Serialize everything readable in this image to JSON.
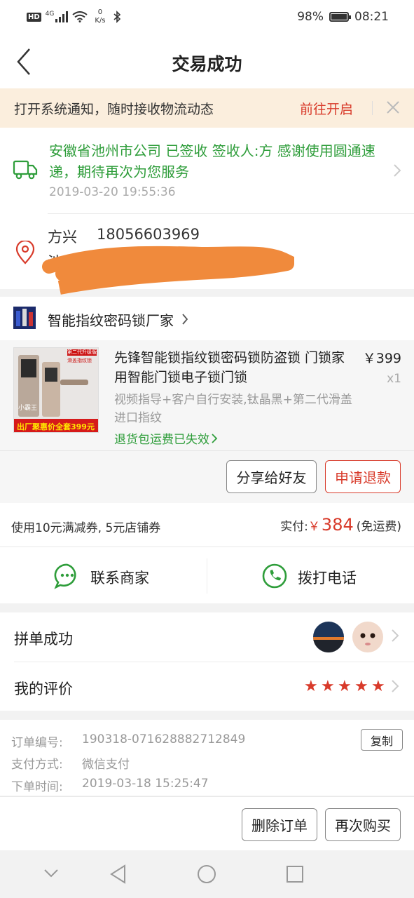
{
  "status_bar": {
    "hd": "HD",
    "network": "4G",
    "speed_value": "0",
    "speed_unit": "K/s",
    "battery": "98%",
    "battery_level": 0.98,
    "time": "08:21"
  },
  "header": {
    "title": "交易成功"
  },
  "notice": {
    "text": "打开系统通知，随时接收物流动态",
    "action": "前往开启"
  },
  "logistics": {
    "status": "安徽省池州市公司 已签收 签收人:方 感谢使用圆通速递，期待再次为您服务",
    "time": "2019-03-20 19:55:36"
  },
  "address": {
    "name": "方兴",
    "phone": "18056603969",
    "line": "池州市 贵池区 ·· 栋8号楼 ·· 1"
  },
  "shop": {
    "name": "智能指纹密码锁厂家"
  },
  "product": {
    "title": "先锋智能锁指纹锁密码锁防盗锁 门锁家用智能门锁电子锁门锁",
    "price": "￥399",
    "qty": "x1",
    "spec": "视频指导+客户自行安装,钛晶黑+第二代滑盖进口指纹",
    "policy": "退货包运费已失效",
    "image_text_top": "第二代升级版",
    "image_text_sub": "滑盖指纹锁",
    "image_text_brand": "小霸王",
    "image_text_bottom": "出厂聚惠价全套399元"
  },
  "actions": {
    "share": "分享给好友",
    "refund": "申请退款"
  },
  "payment": {
    "coupon": "使用10元满减券, 5元店铺券",
    "paid_label": "实付:",
    "currency": "￥",
    "amount": "384",
    "shipping": "(免运费)"
  },
  "contact": {
    "merchant": "联系商家",
    "call": "拨打电话"
  },
  "group": {
    "label": "拼单成功"
  },
  "review": {
    "label": "我的评价",
    "stars": 5
  },
  "order": {
    "number_label": "订单编号:",
    "number": "190318-071628882712849",
    "copy": "复制",
    "pay_method_label": "支付方式:",
    "pay_method": "微信支付",
    "time_label": "下单时间:",
    "time": "2019-03-18 15:25:47"
  },
  "footer": {
    "delete": "删除订单",
    "rebuy": "再次购买"
  },
  "colors": {
    "accent_red": "#d83a2a",
    "success_green": "#2e9d3a",
    "notice_bg": "#fbeedd"
  }
}
